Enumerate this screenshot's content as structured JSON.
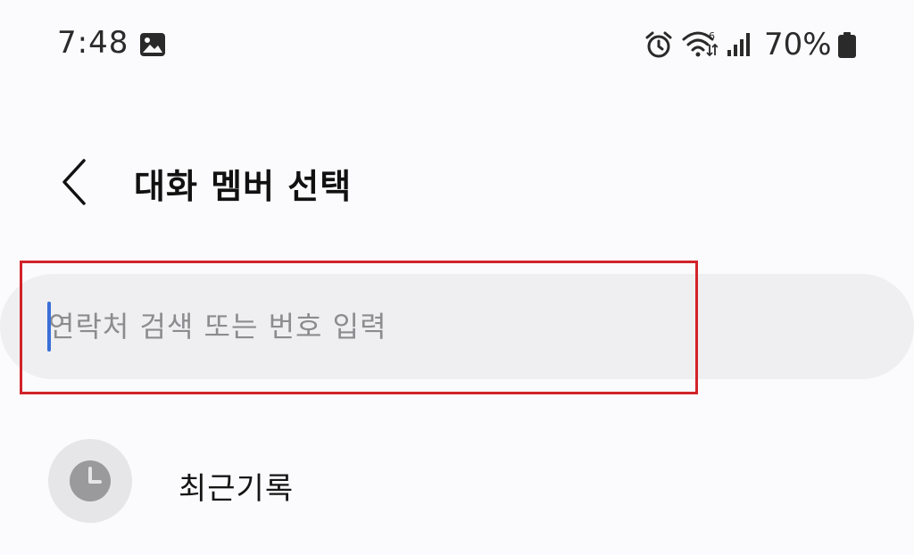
{
  "status_bar": {
    "time": "7:48",
    "battery_percent": "70%",
    "icons": [
      "gallery-icon",
      "alarm-icon",
      "wifi-icon",
      "signal-icon",
      "battery-icon"
    ]
  },
  "header": {
    "title": "대화 멤버 선택",
    "back_icon": "chevron-left-icon"
  },
  "search": {
    "placeholder": "연락처 검색 또는 번호 입력",
    "value": ""
  },
  "recent": {
    "label": "최근기록",
    "icon": "clock-icon"
  },
  "colors": {
    "background": "#fbfbfd",
    "search_bg": "#efeff1",
    "caret": "#3b6fd8",
    "highlight": "#d2232a",
    "avatar_bg": "#e6e6e8",
    "icon_gray": "#9a9a9c"
  }
}
